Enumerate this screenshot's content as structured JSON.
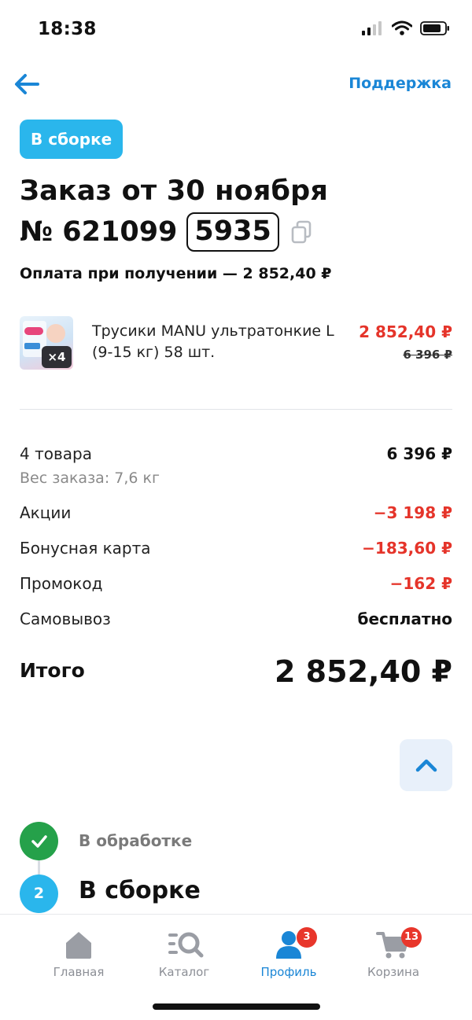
{
  "status_bar": {
    "time": "18:38"
  },
  "nav": {
    "support_label": "Поддержка"
  },
  "order": {
    "status_chip": "В сборке",
    "title": "Заказ от 30 ноября",
    "number_prefix": "№ 621099",
    "number_suffix": "5935",
    "payment": "Оплата при получении — 2 852,40 ₽"
  },
  "product": {
    "name": "Трусики MANU ультратонкие L (9-15 кг) 58 шт.",
    "qty_badge": "×4",
    "price": "2 852,40 ₽",
    "old_price": "6 396 ₽"
  },
  "summary": {
    "items_label": "4 товара",
    "items_value": "6 396 ₽",
    "weight": "Вес заказа: 7,6 кг",
    "rows": [
      {
        "label": "Акции",
        "value": "−3 198 ₽"
      },
      {
        "label": "Бонусная карта",
        "value": "−183,60 ₽"
      },
      {
        "label": "Промокод",
        "value": "−162 ₽"
      },
      {
        "label": "Самовывоз",
        "value": "бесплатно"
      }
    ],
    "total_label": "Итого",
    "total_value": "2 852,40 ₽"
  },
  "timeline": {
    "step1_label": "В обработке",
    "step2_number": "2",
    "step2_label": "В сборке"
  },
  "tabs": [
    {
      "label": "Главная",
      "icon": "home-icon"
    },
    {
      "label": "Каталог",
      "icon": "catalog-search-icon"
    },
    {
      "label": "Профиль",
      "icon": "profile-icon",
      "badge": "3"
    },
    {
      "label": "Корзина",
      "icon": "cart-icon",
      "badge": "13"
    }
  ],
  "colors": {
    "accent": "#1a86d6",
    "chip": "#2ab6ec",
    "discount": "#e5342a",
    "done": "#25a14a",
    "badge": "#e8362b"
  }
}
